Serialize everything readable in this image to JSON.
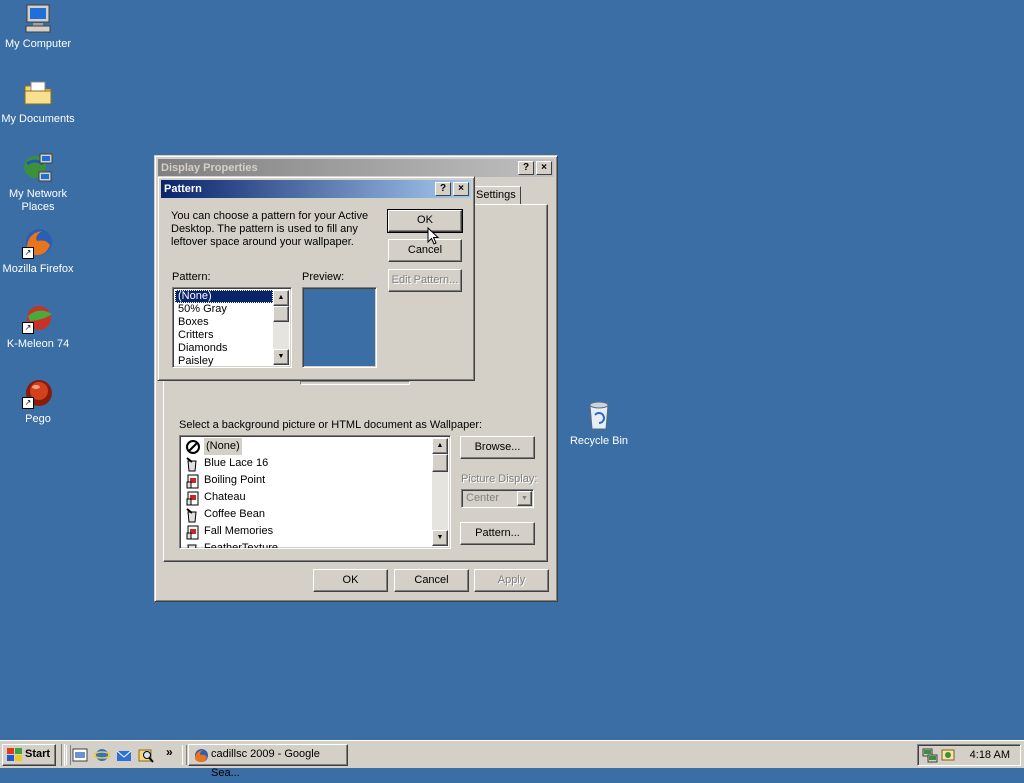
{
  "desktop": {
    "icons": [
      {
        "label": "My Computer",
        "icon": "computer-icon"
      },
      {
        "label": "My Documents",
        "icon": "folder-icon"
      },
      {
        "label": "My Network Places",
        "icon": "network-icon"
      },
      {
        "label": "Mozilla Firefox",
        "icon": "firefox-icon"
      },
      {
        "label": "K-Meleon 74",
        "icon": "kmeleon-icon"
      },
      {
        "label": "Pego",
        "icon": "pego-icon"
      },
      {
        "label": "Recycle Bin",
        "icon": "recycle-bin-icon"
      }
    ]
  },
  "display_props": {
    "title": "Display Properties",
    "help_glyph": "?",
    "close_glyph": "×",
    "tab_settings": "Settings",
    "wallpaper_label": "Select a background picture or HTML document as Wallpaper:",
    "wallpapers": [
      "(None)",
      "Blue Lace 16",
      "Boiling Point",
      "Chateau",
      "Coffee Bean",
      "Fall Memories",
      "FeatherTexture"
    ],
    "browse_label": "Browse...",
    "picture_display_label": "Picture Display:",
    "picture_display_value": "Center",
    "pattern_button_label": "Pattern...",
    "ok_label": "OK",
    "cancel_label": "Cancel",
    "apply_label": "Apply"
  },
  "pattern_dialog": {
    "title": "Pattern",
    "help_glyph": "?",
    "close_glyph": "×",
    "description": "You can choose a pattern for your Active Desktop.  The pattern is used to fill any leftover space around your wallpaper.",
    "ok_label": "OK",
    "cancel_label": "Cancel",
    "edit_pattern_label": "Edit Pattern...",
    "pattern_label": "Pattern:",
    "preview_label": "Preview:",
    "patterns": [
      "(None)",
      "50% Gray",
      "Boxes",
      "Critters",
      "Diamonds",
      "Paisley"
    ],
    "selected": "(None)",
    "preview_color": "#3a6ea5"
  },
  "taskbar": {
    "start_label": "Start",
    "task_label": "cadillsc 2009 - Google Sea...",
    "chevron": "»",
    "clock": "4:18 AM"
  },
  "colors": {
    "desktop": "#3a6ea5",
    "face": "#d4d0c8",
    "title_active": "#0a246a"
  }
}
